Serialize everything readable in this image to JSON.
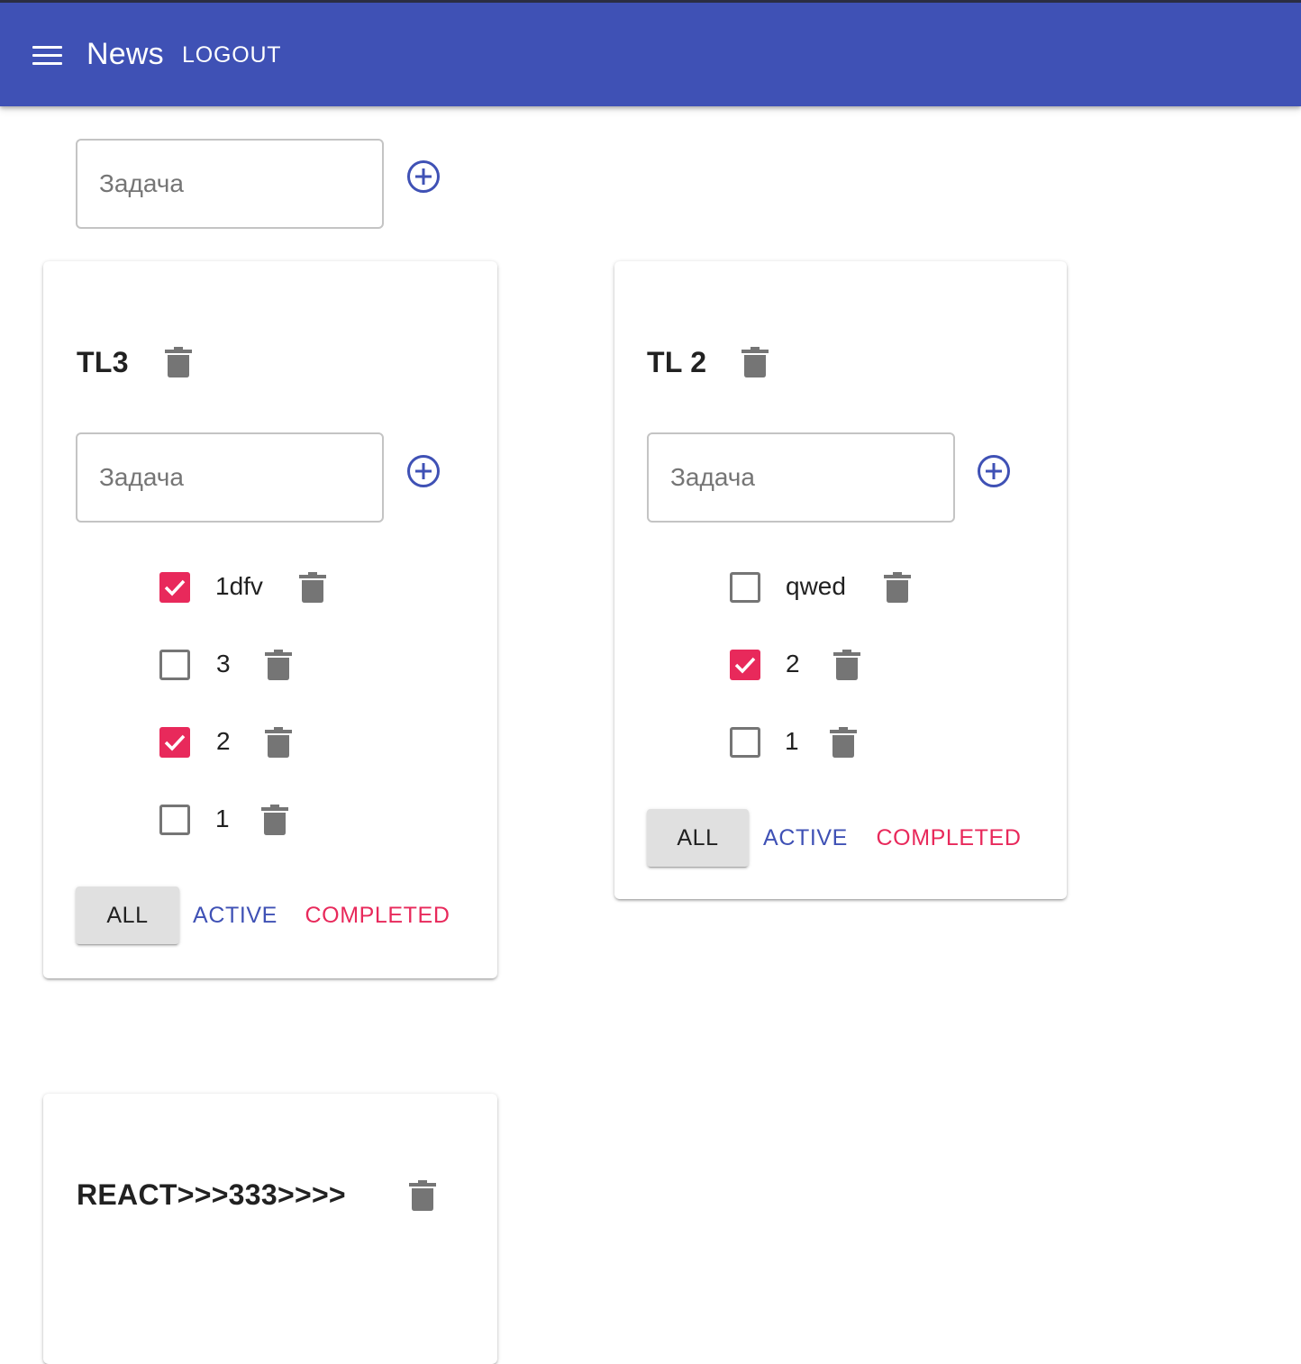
{
  "appbar": {
    "title": "News",
    "logout_label": "LOGOUT",
    "background_color": "#3f51b5"
  },
  "new_list": {
    "placeholder": "Задача"
  },
  "colors": {
    "primary": "#3f51b5",
    "secondary": "#e8295b",
    "icon_gray": "#757575"
  },
  "todolists": [
    {
      "title": "TL3",
      "placeholder": "Задача",
      "tasks": [
        {
          "label": "1dfv",
          "done": true
        },
        {
          "label": "3",
          "done": false
        },
        {
          "label": "2",
          "done": true
        },
        {
          "label": "1",
          "done": false
        }
      ],
      "filters": {
        "all": "ALL",
        "active": "ACTIVE",
        "completed": "COMPLETED"
      }
    },
    {
      "title": "TL 2",
      "placeholder": "Задача",
      "tasks": [
        {
          "label": "qwed",
          "done": false
        },
        {
          "label": "2",
          "done": true
        },
        {
          "label": "1",
          "done": false
        }
      ],
      "filters": {
        "all": "ALL",
        "active": "ACTIVE",
        "completed": "COMPLETED"
      }
    },
    {
      "title": "REACT>>>333>>>>"
    }
  ]
}
